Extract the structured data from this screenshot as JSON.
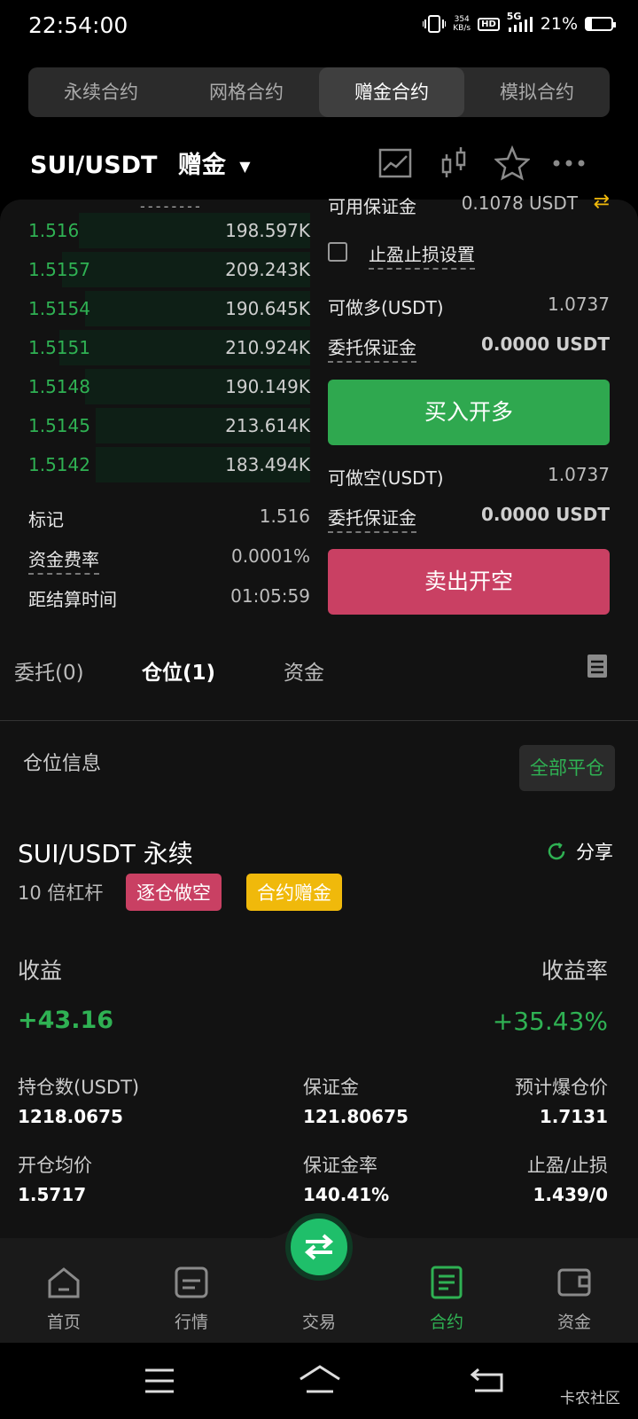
{
  "status": {
    "time": "22:54:00",
    "speed": "354",
    "speed_unit": "KB/s",
    "hd": "HD",
    "network": "5G",
    "battery": "21%"
  },
  "tabs": [
    "永续合约",
    "网格合约",
    "赠金合约",
    "模拟合约"
  ],
  "pair": {
    "name": "SUI/USDT",
    "mode": "赠金"
  },
  "orderbook": {
    "dots": "- - - - - - - -",
    "rows": [
      {
        "price": "1.516",
        "qty": "198.597K",
        "depth": 0.82
      },
      {
        "price": "1.5157",
        "qty": "209.243K",
        "depth": 0.88
      },
      {
        "price": "1.5154",
        "qty": "190.645K",
        "depth": 0.8
      },
      {
        "price": "1.5151",
        "qty": "210.924K",
        "depth": 0.89
      },
      {
        "price": "1.5148",
        "qty": "190.149K",
        "depth": 0.8
      },
      {
        "price": "1.5145",
        "qty": "213.614K",
        "depth": 0.76
      },
      {
        "price": "1.5142",
        "qty": "183.494K",
        "depth": 0.76
      }
    ]
  },
  "market_info": {
    "mark_label": "标记",
    "mark_value": "1.516",
    "funding_label": "资金费率",
    "funding_value": "0.0001%",
    "settle_label": "距结算时间",
    "settle_value": "01:05:59"
  },
  "trade_panel": {
    "avail_label": "可用保证金",
    "avail_value": "0.1078 USDT",
    "tpsl_label": "止盈止损设置",
    "long_label": "可做多(USDT)",
    "long_value": "1.0737",
    "long_margin_label": "委托保证金",
    "long_margin_value": "0.0000 USDT",
    "buy_label": "买入开多",
    "short_label": "可做空(USDT)",
    "short_value": "1.0737",
    "short_margin_label": "委托保证金",
    "short_margin_value": "0.0000 USDT",
    "sell_label": "卖出开空"
  },
  "order_tabs": [
    "委托(0)",
    "仓位(1)",
    "资金"
  ],
  "position": {
    "section_title": "仓位信息",
    "close_all": "全部平仓",
    "symbol": "SUI/USDT 永续",
    "share": "分享",
    "leverage": "10 倍杠杆",
    "tag_short": "逐仓做空",
    "tag_bonus": "合约赠金",
    "pnl_label": "收益",
    "pnl_value": "+43.16",
    "roe_label": "收益率",
    "roe_value": "+35.43%",
    "size_label": "持仓数(USDT)",
    "size_value": "1218.0675",
    "margin_label": "保证金",
    "margin_value": "121.80675",
    "liq_label": "预计爆仓价",
    "liq_value": "1.7131",
    "entry_label": "开仓均价",
    "entry_value": "1.5717",
    "margin_ratio_label": "保证金率",
    "margin_ratio_value": "140.41%",
    "tpsl_label": "止盈/止损",
    "tpsl_value": "1.439/0"
  },
  "nav": [
    "首页",
    "行情",
    "交易",
    "合约",
    "资金"
  ],
  "watermark": "卡农社区",
  "colors": {
    "green": "#2fb153",
    "red": "#c94063",
    "yellow": "#f0b90b",
    "accent": "#2fb153"
  }
}
